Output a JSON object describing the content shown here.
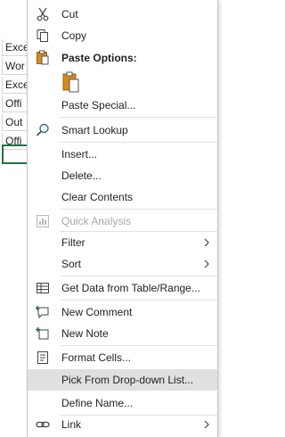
{
  "sheet": {
    "cells": [
      "Exce",
      "Wor",
      "Exce",
      "Offi",
      "Out",
      "Offi",
      ""
    ]
  },
  "menu": {
    "cut": "Cut",
    "copy": "Copy",
    "paste_options": "Paste Options:",
    "paste_special": "Paste Special...",
    "smart_lookup": "Smart Lookup",
    "insert": "Insert...",
    "delete": "Delete...",
    "clear_contents": "Clear Contents",
    "quick_analysis": "Quick Analysis",
    "filter": "Filter",
    "sort": "Sort",
    "get_data": "Get Data from Table/Range...",
    "new_comment": "New Comment",
    "new_note": "New Note",
    "format_cells": "Format Cells...",
    "pick_list": "Pick From Drop-down List...",
    "define_name": "Define Name...",
    "link": "Link"
  },
  "colors": {
    "excel_green": "#217346",
    "paste_orange": "#d88b1b",
    "hover_gray": "#e0e0e0",
    "icon_blue": "#2b6cb0"
  }
}
